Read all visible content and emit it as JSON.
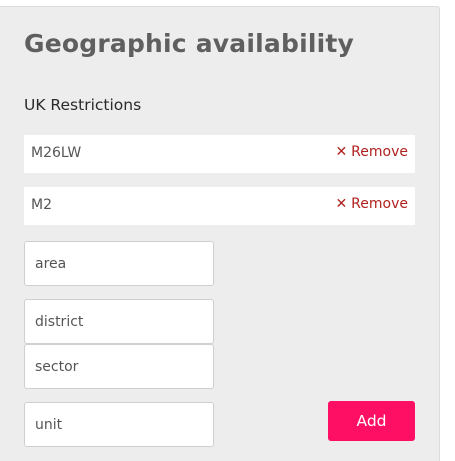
{
  "panel": {
    "title": "Geographic availability",
    "section_label": "UK Restrictions",
    "restrictions": [
      {
        "value": "M26LW",
        "remove_label": "Remove",
        "remove_icon": "close-icon"
      },
      {
        "value": "M2",
        "remove_label": "Remove",
        "remove_icon": "close-icon"
      }
    ],
    "inputs": {
      "area": {
        "value": "",
        "placeholder": "area"
      },
      "district": {
        "value": "",
        "placeholder": "district"
      },
      "sector": {
        "value": "",
        "placeholder": "sector"
      },
      "unit": {
        "value": "",
        "placeholder": "unit"
      }
    },
    "add_label": "Add"
  },
  "colors": {
    "panel_bg": "#ededed",
    "accent": "#ff0f63",
    "remove_link": "#b0221f",
    "title": "#5f5f5f"
  }
}
